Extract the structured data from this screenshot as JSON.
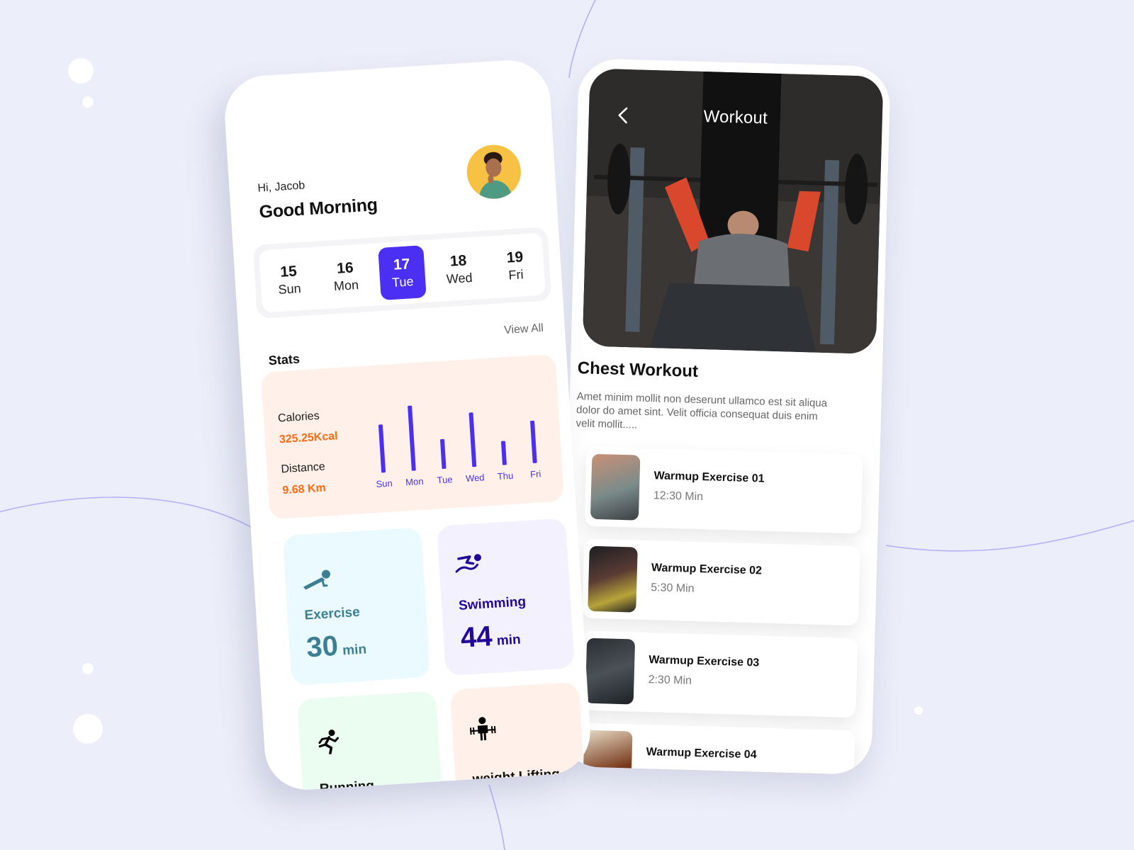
{
  "colors": {
    "background": "#eceef9",
    "accent": "#4b2ff2",
    "orange": "#ff6a14",
    "stats_card_bg": "#fff1e9",
    "exercise_bg": "#eafaff",
    "exercise_fg": "#3c7f95",
    "swimming_bg": "#f3f1fd",
    "swimming_fg": "#21089b",
    "running_bg": "#ebfdf0",
    "weight_bg": "#fff1e9",
    "decor_line": "#b8b0f5"
  },
  "home": {
    "greeting_small": "Hi, Jacob",
    "greeting_large": "Good Morning",
    "dates": [
      {
        "num": "15",
        "day": "Sun",
        "active": false
      },
      {
        "num": "16",
        "day": "Mon",
        "active": false
      },
      {
        "num": "17",
        "day": "Tue",
        "active": true
      },
      {
        "num": "18",
        "day": "Wed",
        "active": false
      },
      {
        "num": "19",
        "day": "Fri",
        "active": false
      }
    ],
    "stats_title": "Stats",
    "view_all": "View All",
    "calories_label": "Calories",
    "calories_value": "325.25Kcal",
    "distance_label": "Distance",
    "distance_value": "9.68 Km",
    "tiles": {
      "exercise": {
        "label": "Exercise",
        "value": "30",
        "unit": "min"
      },
      "swimming": {
        "label": "Swimming",
        "value": "44",
        "unit": "min"
      },
      "running": {
        "label": "Running"
      },
      "weight": {
        "label": "weight Lifting"
      }
    }
  },
  "chart_data": {
    "type": "bar",
    "title": "",
    "xlabel": "",
    "ylabel": "",
    "categories": [
      "Sun",
      "Mon",
      "Tue",
      "Wed",
      "Thu",
      "Fri"
    ],
    "values": [
      68,
      92,
      42,
      77,
      34,
      60
    ],
    "ylim": [
      0,
      100
    ],
    "grid": false,
    "legend": "none"
  },
  "workout": {
    "header_title": "Workout",
    "title": "Chest Workout",
    "description": "Amet minim mollit non deserunt ullamco est sit aliqua dolor do amet sint. Velit officia consequat duis enim velit mollit.....",
    "exercises": [
      {
        "name": "Warmup Exercise 01",
        "time": "12:30 Min"
      },
      {
        "name": "Warmup Exercise 02",
        "time": "5:30 Min"
      },
      {
        "name": "Warmup Exercise 03",
        "time": "2:30 Min"
      },
      {
        "name": "Warmup Exercise 04",
        "time": ""
      }
    ]
  }
}
